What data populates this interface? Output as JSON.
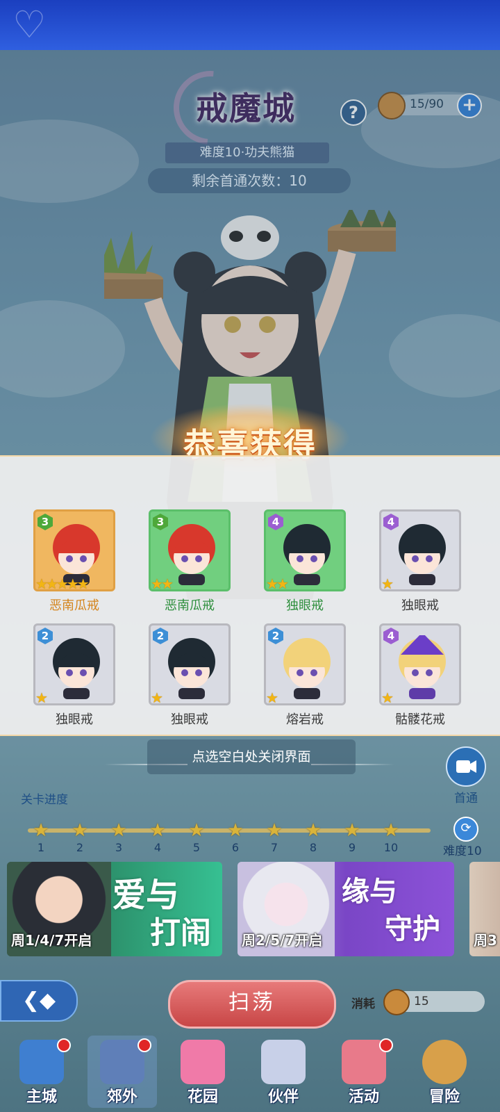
{
  "stage": {
    "title": "戒魔城",
    "difficulty": "难度10·功夫熊猫",
    "first_clears": "剩余首通次数：10"
  },
  "stamina": {
    "value": "15/90",
    "icon": "burger-icon"
  },
  "reward_popup": {
    "title": "恭喜获得",
    "close_tip": "点选空白处关闭界面",
    "items": [
      {
        "name": "恶南瓜戒",
        "level": "3",
        "stars": 5,
        "frame": "orange"
      },
      {
        "name": "恶南瓜戒",
        "level": "3",
        "stars": 2,
        "frame": "green"
      },
      {
        "name": "独眼戒",
        "level": "4",
        "stars": 2,
        "frame": "green"
      },
      {
        "name": "独眼戒",
        "level": "4",
        "stars": 1,
        "frame": "grey"
      },
      {
        "name": "独眼戒",
        "level": "2",
        "stars": 1,
        "frame": "grey"
      },
      {
        "name": "独眼戒",
        "level": "2",
        "stars": 1,
        "frame": "grey"
      },
      {
        "name": "熔岩戒",
        "level": "2",
        "stars": 1,
        "frame": "grey"
      },
      {
        "name": "骷髅花戒",
        "level": "4",
        "stars": 1,
        "frame": "grey"
      }
    ]
  },
  "first_clear_video": {
    "label": "首通"
  },
  "progress": {
    "label": "关卡进度",
    "stages": [
      "1",
      "2",
      "3",
      "4",
      "5",
      "6",
      "7",
      "8",
      "9",
      "10"
    ],
    "difficulty": "难度10"
  },
  "events": [
    {
      "title_1": "爱与",
      "title_2": "打闹",
      "schedule": "周1/4/7开启"
    },
    {
      "title_1": "缘与",
      "title_2": "守护",
      "schedule": "周2/5/7开启"
    },
    {
      "schedule": "周3"
    }
  ],
  "sweep": {
    "label": "扫荡",
    "cost_label": "消耗",
    "cost_value": "15"
  },
  "nav": [
    {
      "label": "主城",
      "badge": true
    },
    {
      "label": "郊外",
      "badge": true
    },
    {
      "label": "花园",
      "badge": false
    },
    {
      "label": "伙伴",
      "badge": false
    },
    {
      "label": "活动",
      "badge": true
    },
    {
      "label": "冒险",
      "badge": false
    }
  ]
}
